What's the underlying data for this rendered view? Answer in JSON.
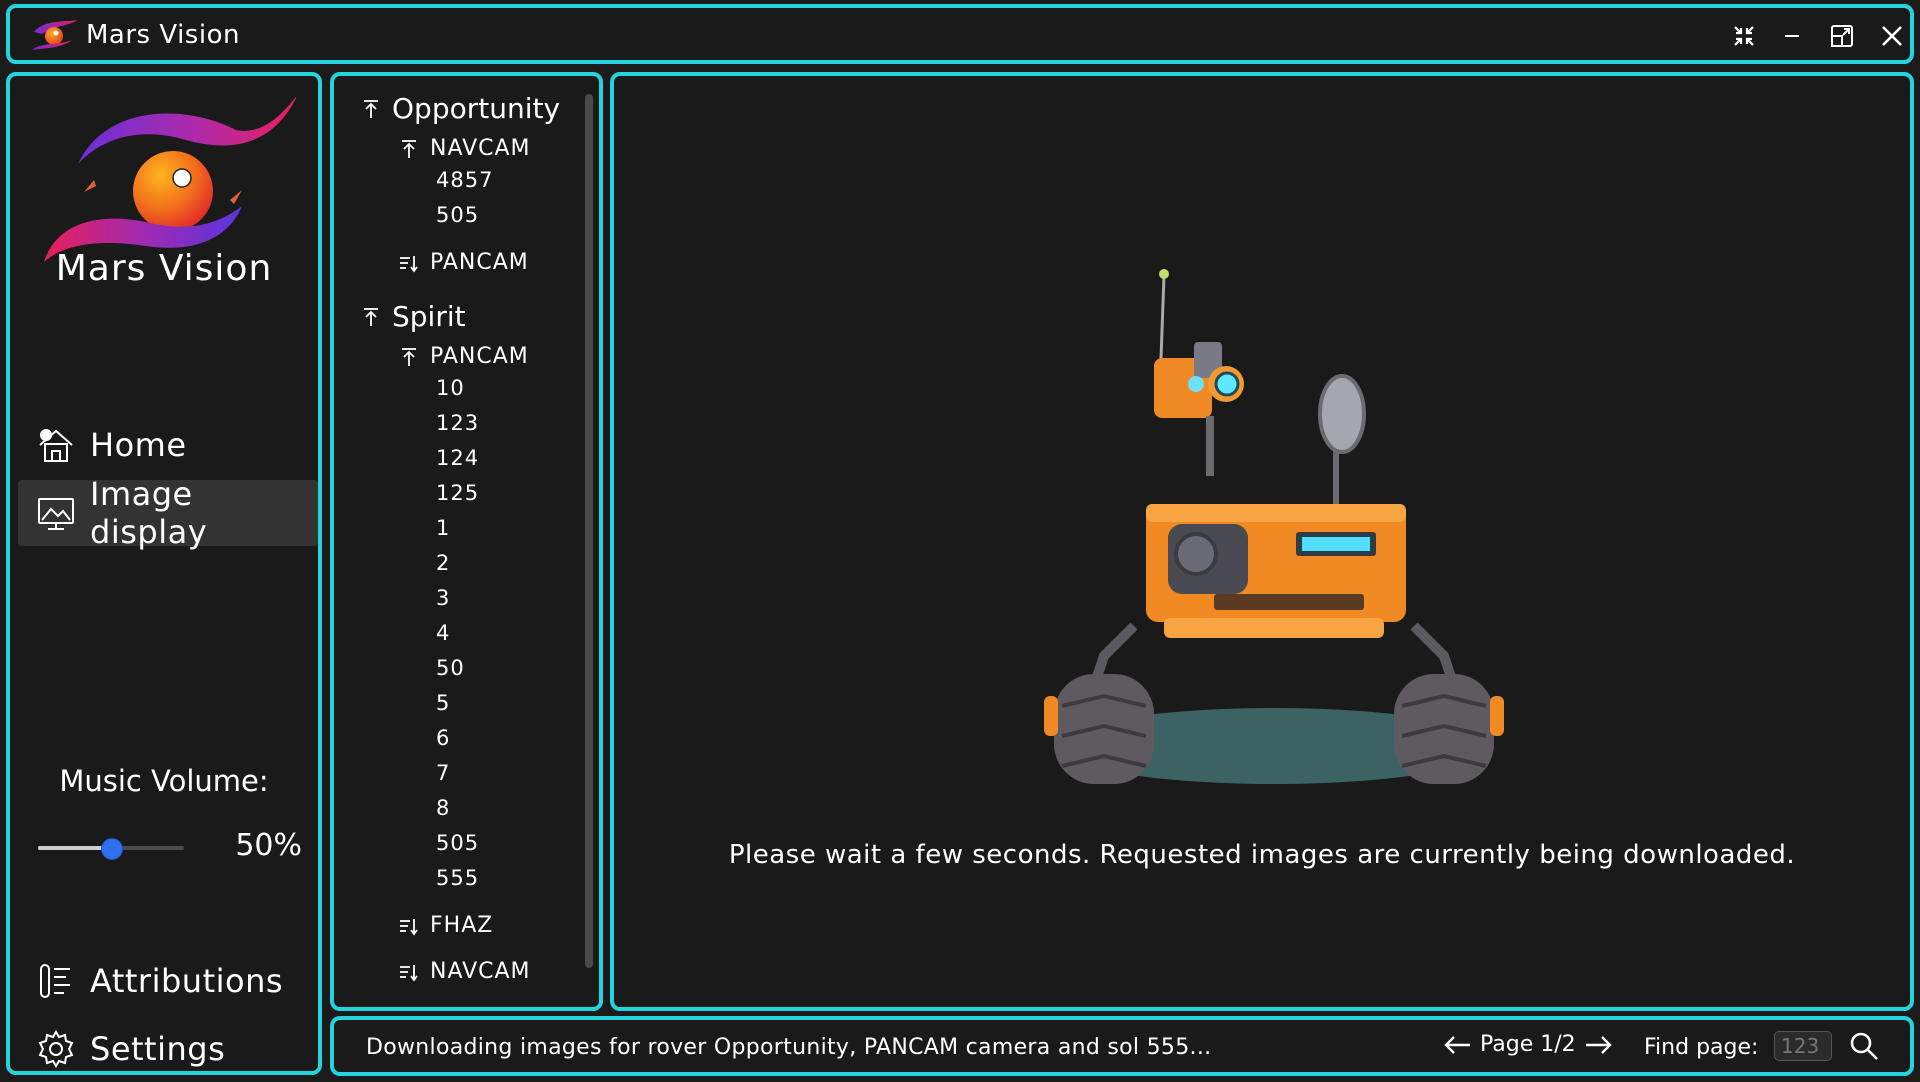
{
  "window": {
    "title": "Mars Vision",
    "controls": [
      "compact-icon",
      "minimize-icon",
      "restore-icon",
      "close-icon"
    ]
  },
  "sidebar": {
    "logo_text": "Mars Vision",
    "nav": [
      {
        "label": "Home",
        "icon": "home-icon",
        "active": false
      },
      {
        "label": "Image display",
        "icon": "image-display-icon",
        "active": true
      }
    ],
    "volume": {
      "label": "Music Volume:",
      "value_text": "50%",
      "value": 0.5
    },
    "bottom_nav": [
      {
        "label": "Attributions",
        "icon": "attributions-icon"
      },
      {
        "label": "Settings",
        "icon": "gear-icon"
      }
    ]
  },
  "tree": [
    {
      "rover": "Opportunity",
      "cameras": [
        {
          "name": "NAVCAM",
          "expanded": true,
          "sols": [
            "4857",
            "505"
          ]
        },
        {
          "name": "PANCAM",
          "expanded": false,
          "sols": []
        }
      ]
    },
    {
      "rover": "Spirit",
      "cameras": [
        {
          "name": "PANCAM",
          "expanded": true,
          "sols": [
            "10",
            "123",
            "124",
            "125",
            "1",
            "2",
            "3",
            "4",
            "50",
            "5",
            "6",
            "7",
            "8",
            "505",
            "555"
          ]
        },
        {
          "name": "FHAZ",
          "expanded": false,
          "sols": []
        },
        {
          "name": "NAVCAM",
          "expanded": false,
          "sols": []
        }
      ]
    }
  ],
  "main": {
    "message": "Please wait a few seconds. Requested images are currently being downloaded."
  },
  "status": {
    "text": "Downloading images for rover Opportunity, PANCAM camera and sol 555...",
    "page_label": "Page 1/2",
    "find_label": "Find page:",
    "find_placeholder": "123"
  },
  "colors": {
    "accent": "#25d3dc",
    "background": "#1a1a1a",
    "active_nav": "#333333",
    "slider_knob": "#2f6ff0"
  }
}
